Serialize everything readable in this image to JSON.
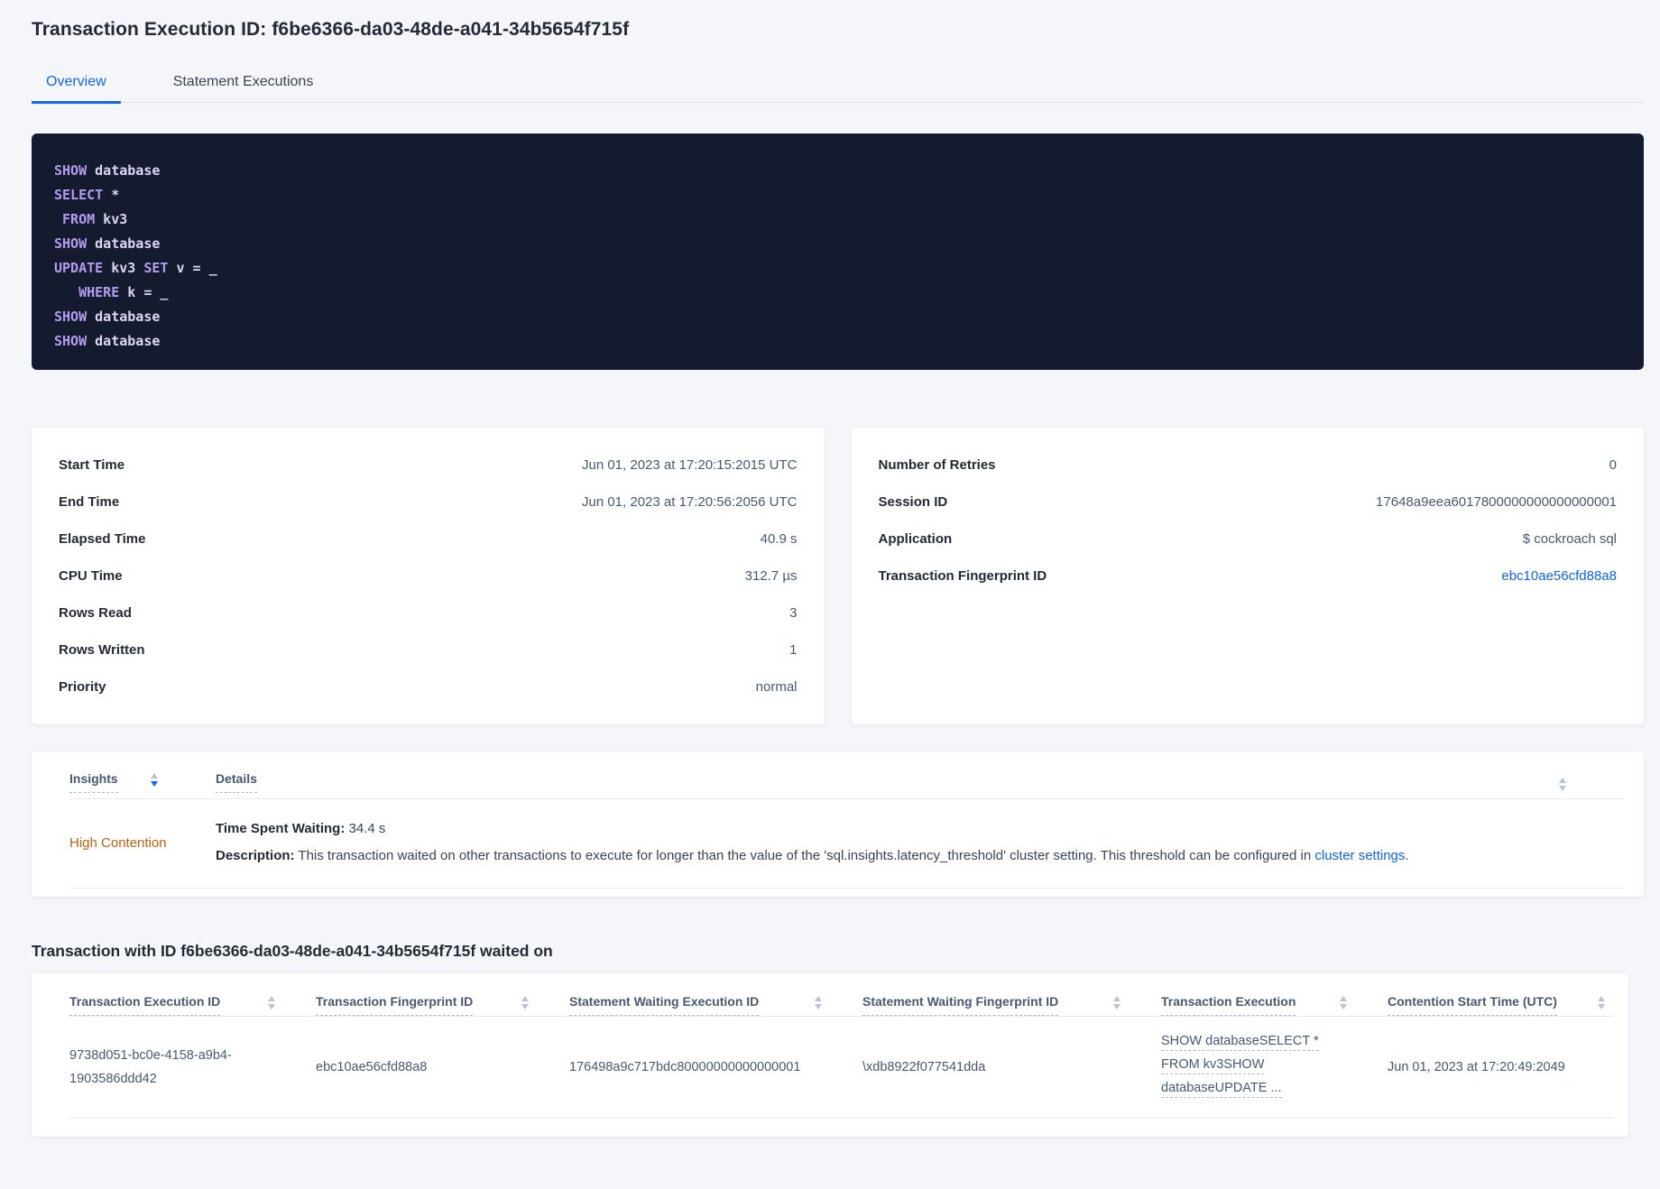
{
  "header": {
    "title": "Transaction Execution ID: f6be6366-da03-48de-a041-34b5654f715f",
    "tabs": {
      "overview": "Overview",
      "statement_executions": "Statement Executions"
    }
  },
  "sql": {
    "lines": [
      [
        {
          "k": "kw",
          "t": "SHOW"
        },
        {
          "k": "pl",
          "t": " database"
        }
      ],
      [
        {
          "k": "kw",
          "t": "SELECT"
        },
        {
          "k": "pl",
          "t": " *"
        }
      ],
      [
        {
          "k": "pl",
          "t": " "
        },
        {
          "k": "kw",
          "t": "FROM"
        },
        {
          "k": "pl",
          "t": " kv3"
        }
      ],
      [
        {
          "k": "kw",
          "t": "SHOW"
        },
        {
          "k": "pl",
          "t": " database"
        }
      ],
      [
        {
          "k": "kw",
          "t": "UPDATE"
        },
        {
          "k": "pl",
          "t": " kv3 "
        },
        {
          "k": "kw",
          "t": "SET"
        },
        {
          "k": "pl",
          "t": " v = _"
        }
      ],
      [
        {
          "k": "pl",
          "t": "   "
        },
        {
          "k": "kw",
          "t": "WHERE"
        },
        {
          "k": "pl",
          "t": " k = _"
        }
      ],
      [
        {
          "k": "kw",
          "t": "SHOW"
        },
        {
          "k": "pl",
          "t": " database"
        }
      ],
      [
        {
          "k": "kw",
          "t": "SHOW"
        },
        {
          "k": "pl",
          "t": " database"
        }
      ]
    ]
  },
  "details_left": {
    "rows": [
      {
        "label": "Start Time",
        "value": "Jun 01, 2023 at 17:20:15:2015 UTC"
      },
      {
        "label": "End Time",
        "value": "Jun 01, 2023 at 17:20:56:2056 UTC"
      },
      {
        "label": "Elapsed Time",
        "value": "40.9 s"
      },
      {
        "label": "CPU Time",
        "value": "312.7 µs"
      },
      {
        "label": "Rows Read",
        "value": "3"
      },
      {
        "label": "Rows Written",
        "value": "1"
      },
      {
        "label": "Priority",
        "value": "normal"
      }
    ]
  },
  "details_right": {
    "rows": [
      {
        "label": "Number of Retries",
        "value": "0"
      },
      {
        "label": "Session ID",
        "value": "17648a9eea6017800000000000000001"
      },
      {
        "label": "Application",
        "value": "$ cockroach sql"
      },
      {
        "label": "Transaction Fingerprint ID",
        "value": "ebc10ae56cfd88a8"
      }
    ]
  },
  "insights": {
    "columns": {
      "insights": "Insights",
      "details": "Details"
    },
    "row": {
      "insight": "High Contention",
      "waiting_label": "Time Spent Waiting:",
      "waiting_value": " 34.4 s",
      "description_label": "Description:",
      "description_text": " This transaction waited on other transactions to execute for longer than the value of the 'sql.insights.latency_threshold' cluster setting. This threshold can be configured in ",
      "description_link": "cluster settings",
      "description_suffix": "."
    }
  },
  "waited_on": {
    "heading": "Transaction with ID f6be6366-da03-48de-a041-34b5654f715f waited on",
    "columns": [
      "Transaction Execution ID",
      "Transaction Fingerprint ID",
      "Statement Waiting Execution ID",
      "Statement Waiting Fingerprint ID",
      "Transaction Execution",
      "Contention Start Time (UTC)"
    ],
    "row": {
      "transaction_execution_id": "9738d051-bc0e-4158-a9b4-1903586ddd42",
      "transaction_fingerprint_id": "ebc10ae56cfd88a8",
      "statement_waiting_execution_id": "176498a9c717bdc80000000000000001",
      "statement_waiting_fingerprint_id": "\\xdb8922f077541dda",
      "transaction_execution_lines": [
        "SHOW databaseSELECT *",
        "FROM kv3SHOW",
        "databaseUPDATE ..."
      ],
      "contention_start_time": "Jun 01, 2023 at 17:20:49:2049"
    }
  },
  "colors": {
    "accent_blue": "#1666f2",
    "link_blue": "#0b63f5",
    "warning_orange": "#bf600f",
    "sql_keyword": "#b49cf0",
    "sql_text": "#ddd8f7",
    "sql_background": "#151b2e"
  }
}
